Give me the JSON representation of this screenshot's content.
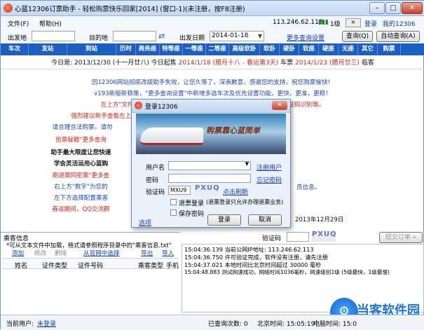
{
  "window": {
    "title": "心蓝12306订票助手 - 轻松购票快乐回家[2014] (窗口-1)(未注册，按F8注册)",
    "controls": {
      "minimize": "–",
      "maximize": "□",
      "close": "✕"
    }
  },
  "menu": {
    "file": "文件(F)",
    "help": "帮助(H)",
    "ip": "113.246.62.113",
    "level": "1级",
    "login": "登录",
    "my12306": "我的12306"
  },
  "search": {
    "from_label": "出发地",
    "to_label": "目的地",
    "date_label": "出发日期",
    "date_value": "2014-01-18",
    "more_settings": "更多查询设置",
    "query_button": "查询(Q)",
    "auto_query_button": "自动查询(A)"
  },
  "grid": {
    "columns": [
      "车次",
      "发站",
      "到站",
      "历时",
      "商务座",
      "特等座",
      "一等座",
      "二等座",
      "高级软卧",
      "软卧",
      "硬卧",
      "软座",
      "硬座",
      "无座",
      "其它",
      "购票"
    ]
  },
  "date_row": {
    "today_prefix": "今日是: ",
    "today": "2013/12/30 (十一月廿八)",
    "middle": "  今日起售 ",
    "sale_date": "2014/1/18 (腊月十八 - 春运第3天)",
    "suffix": " 车票  ",
    "next_date": "2014/1/23 (腊月廿三)",
    "last": " 临客"
  },
  "notices": [
    {
      "text": "因12306网站彻底改版助手失效，让您久等了，深表歉意，感谢您的支持，祝您购票愉快！",
      "color": "blue"
    },
    {
      "text": "v193新版新稳策，\"更多查询设置\"中新增多选车次及优先设置功能，更快，更准，更稳！",
      "color": "blue"
    },
    {
      "text": "左上方\"文件\"-\"选项\"可更改提示音或设置打码兔，打码兔是一款自动验证码识别等。",
      "color": "red"
    },
    {
      "text": "强烈建议新手查看左上方文件菜单中的使用帮助",
      "color": "red"
    },
    {
      "text": "请合理合法购票，请勿",
      "color": "blue"
    },
    {
      "text": "抢票秘籍\"更多查询",
      "color": "red"
    },
    {
      "text": "助手最大限度让您快速",
      "color": "blk"
    },
    {
      "text": "学会灵活运用心蓝购",
      "color": "blk"
    },
    {
      "text": "刷退票同密票\"更多查",
      "color": "red"
    },
    {
      "text": "右上方\"数字\"为您的",
      "color": "blue"
    },
    {
      "text": "左下方选择配置乘客",
      "color": "blue"
    },
    {
      "text": "春运期间，QQ交流群",
      "color": "red"
    }
  ],
  "notice_right": {
    "r1": "员信息。",
    "r2": "2013年12月29日"
  },
  "dialog": {
    "title": "登录12306",
    "banner_text": "购票靠心蓝简单",
    "username_label": "用户名",
    "password_label": "密码",
    "captcha_label": "验证码",
    "captcha_value": "MXU9",
    "captcha_image": "PXUQ",
    "register_link": "注册用户",
    "forgot_link": "忘记密码",
    "refresh_link": "点击刷新",
    "refund_login": "退票登录",
    "refund_note": "(退票登录只允许办理退票业务)",
    "save_password": "保存密码",
    "options_link": "选项",
    "login_button": "登录",
    "cancel_button": "取消"
  },
  "passenger": {
    "header": "乘客信息",
    "hint": "*可从文本文件中加载，格式请参照程序目录中的\"乘客信息.txt\"",
    "actions": [
      "添加",
      "修改",
      "删除",
      "从官网中选择",
      "导出",
      "导入"
    ],
    "columns": [
      "姓名",
      "证件类型",
      "证件号码",
      "乘客类型",
      "手机"
    ]
  },
  "right_panel": {
    "captcha_label": "验证码",
    "captcha_image": "PXUQ",
    "submit_button": "提交订单 »"
  },
  "log": [
    "15:04:36.139 当前公网IP地址: 113.246.62.113",
    "15:04:36.750 许可验证完成，软件没有注册，请先注册",
    "15:04:37.021 本地时间比北京时间超过 30000 毫秒",
    "15:04:48.883 测试网速成功，网络时间1036毫秒，网速级别1级 (5级最快，1级最慢)"
  ],
  "status": {
    "user_label": "当前用户: ",
    "user_value": "未登录",
    "query_count_label": "已查询次数: 0",
    "beijing_time": "北京时间: 15:05:19",
    "computer_time": "电脑时间: 15:0"
  },
  "watermark": "当客软件园"
}
